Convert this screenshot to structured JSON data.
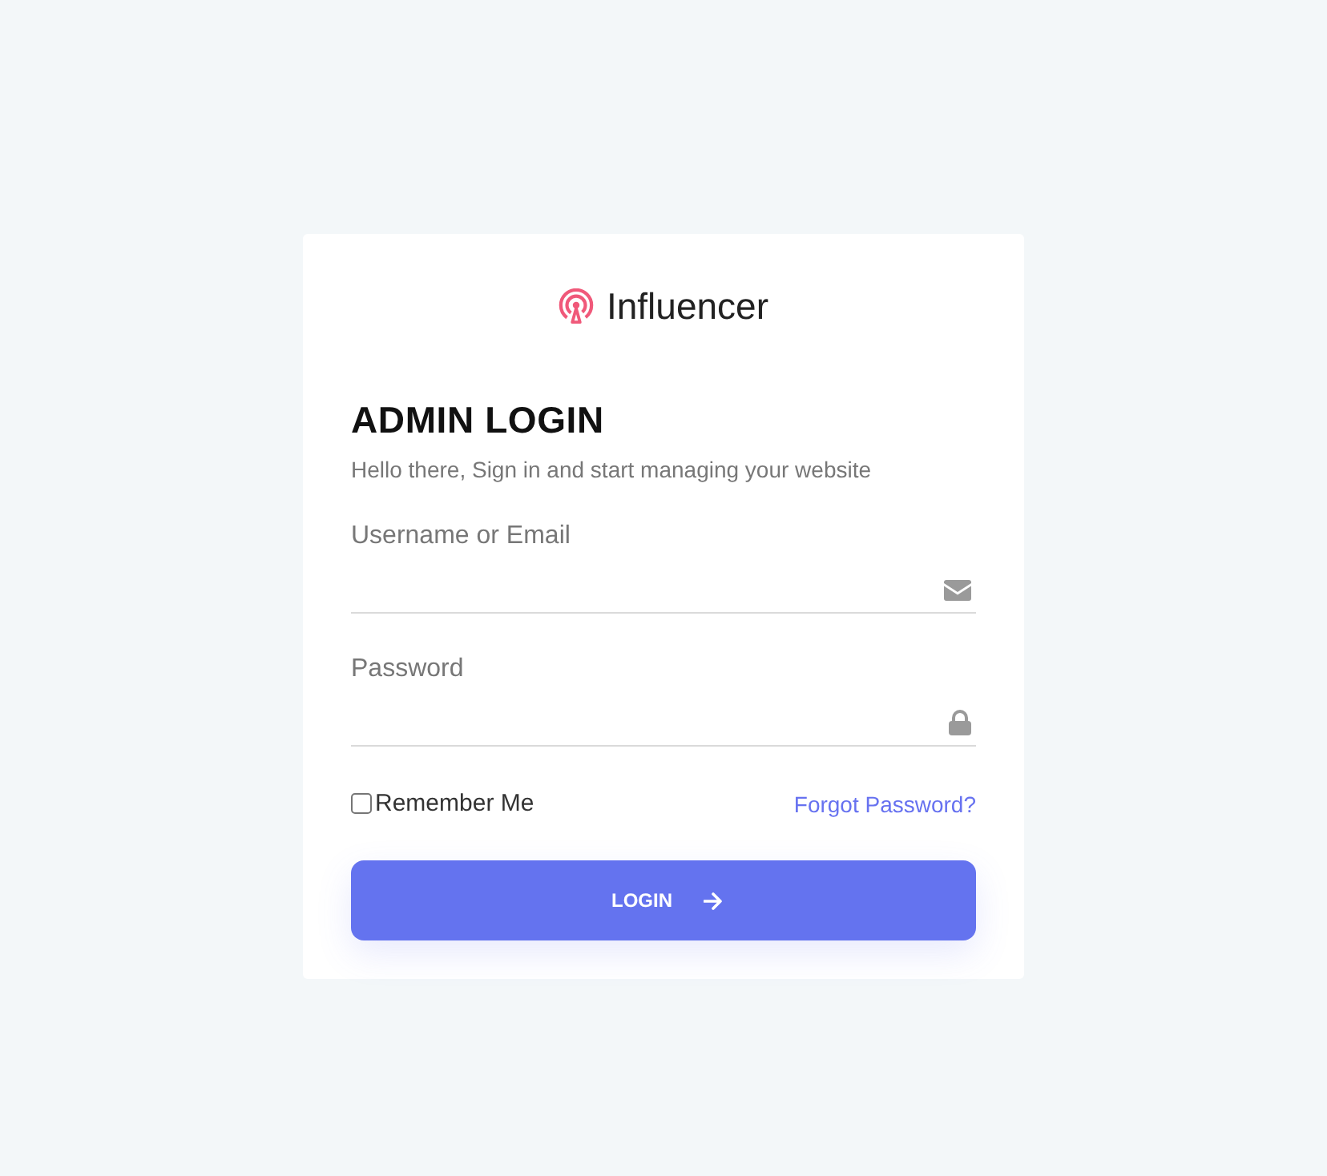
{
  "brand": {
    "name": "Influencer"
  },
  "heading": "ADMIN LOGIN",
  "subtitle": "Hello there, Sign in and start managing your website",
  "fields": [
    {
      "label": "Username or Email",
      "kind": "email"
    },
    {
      "label": "Password",
      "kind": "password"
    }
  ],
  "remember": {
    "label": "Remember Me",
    "checked": false
  },
  "forgot_link": "Forgot Password?",
  "login_button": {
    "label": "LOGIN"
  }
}
